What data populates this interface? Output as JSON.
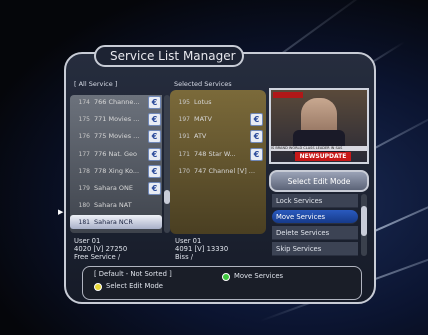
{
  "title": "Service List Manager",
  "left_header": "[ All Service ]",
  "right_header": "Selected Services",
  "left_list": [
    {
      "num": "174",
      "name": "766 Channe...",
      "badge": "€"
    },
    {
      "num": "175",
      "name": "771 Movies ...",
      "badge": "€"
    },
    {
      "num": "176",
      "name": "775 Movies ...",
      "badge": "€"
    },
    {
      "num": "177",
      "name": "776 Nat. Geo",
      "badge": "€"
    },
    {
      "num": "178",
      "name": "778 Xing Ko...",
      "badge": "€"
    },
    {
      "num": "179",
      "name": "Sahara ONE",
      "badge": "€"
    },
    {
      "num": "180",
      "name": "Sahara NAT",
      "badge": ""
    },
    {
      "num": "181",
      "name": "Sahara NCR",
      "badge": ""
    }
  ],
  "right_list": [
    {
      "num": "195",
      "name": "Lotus",
      "badge": ""
    },
    {
      "num": "197",
      "name": "MATV",
      "badge": "€"
    },
    {
      "num": "191",
      "name": "ATV",
      "badge": "€"
    },
    {
      "num": "171",
      "name": "748 Star W...",
      "badge": "€"
    },
    {
      "num": "170",
      "name": "747 Channel [V] ...",
      "badge": ""
    }
  ],
  "left_info": {
    "line1": "User 01",
    "line2": "4020 [V] 27250",
    "line3": "Free Service /"
  },
  "right_info": {
    "line1": "User 01",
    "line2": "4091 [V] 13330",
    "line3": "Biss /"
  },
  "preview": {
    "banner": "NEWSUPDATE",
    "ticker": "IS BRAND WORLD CLASS LEADER IN SAS"
  },
  "edit_mode": {
    "title": "Select Edit Mode",
    "items": [
      "Lock Services",
      "Move Services",
      "Delete Services",
      "Skip Services"
    ],
    "active_index": 1
  },
  "footer": {
    "sort": "[ Default - Not Sorted ]",
    "green_label": "Move Services",
    "yellow_label": "Select Edit Mode"
  },
  "colors": {
    "green": "#3ec53e",
    "yellow": "#e8d83a",
    "accent": "#2a5abf"
  }
}
